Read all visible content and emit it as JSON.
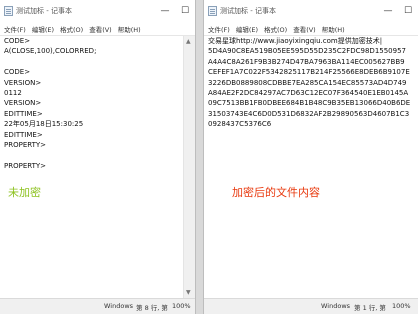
{
  "colors": {
    "left_caption": "#8dc21f",
    "right_caption": "#e8380d"
  },
  "left": {
    "title": "测试加标 - 记事本",
    "menu": [
      "文件(F)",
      "编辑(E)",
      "格式(O)",
      "查看(V)",
      "帮助(H)"
    ],
    "lines": [
      "CODE>",
      "A(CLOSE,100),COLORRED;",
      "",
      "CODE>",
      "VERSION>",
      "0112",
      "VERSION>",
      "EDITTIME>",
      "22年05月18日15:30:25",
      "EDITTIME>",
      "PROPERTY>",
      "",
      "PROPERTY>"
    ],
    "caption": "未加密",
    "status": {
      "os": "Windows",
      "position": "第 8 行, 第",
      "zoom": "100%"
    }
  },
  "right": {
    "title": "测试加标 - 记事本",
    "menu": [
      "文件(F)",
      "编辑(E)",
      "格式(O)",
      "查看(V)",
      "帮助(H)"
    ],
    "lines": [
      "交易星球http://www.jiaoyixingqiu.com提供加密技术|",
      "5D4A90C8EA519B05EE595D55D235C2FDC98D1550957",
      "A4A4C8A261F9B3B274D47BA7963BA114EC005627BB9",
      "CEFEF1A7C022F5342825117B214F25566E8DEB6B9107E",
      "3226DB0889808CDBBE7EA285CA154EC85573AD4D749",
      "A84AE2F2DC84297AC7D63C12EC07F364540E1EB0145A",
      "09C7513BB1FB0DBEE684B1B48C9B35EB13066D40B6DE",
      "31503743E4C6D0D531D6832AF2B29890563D4607B1C3",
      "0928437C5376C6"
    ],
    "caption": "加密后的文件内容",
    "status": {
      "os": "Windows",
      "position": "第 1 行, 第",
      "zoom": "100%"
    }
  }
}
